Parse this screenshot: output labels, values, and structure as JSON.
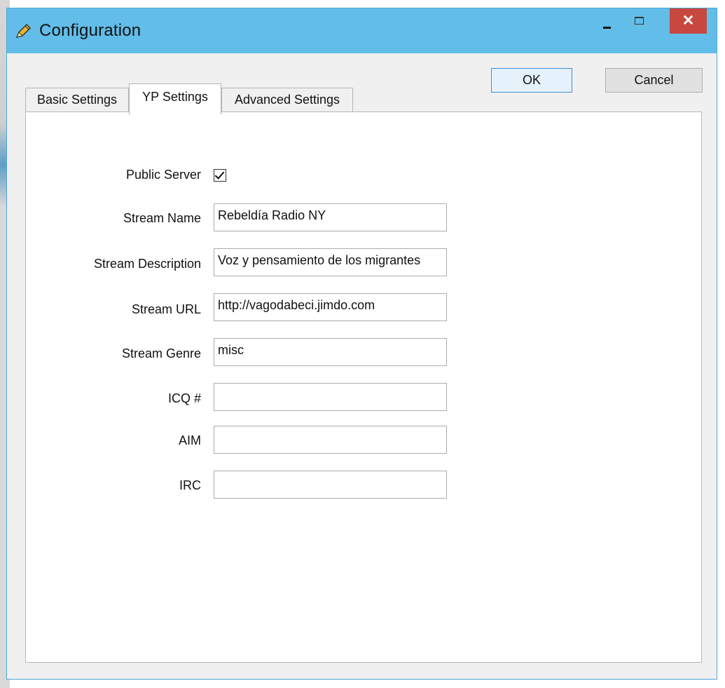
{
  "window": {
    "title": "Configuration",
    "close_glyph": "✕",
    "title_icon": "pencil-icon"
  },
  "buttons": {
    "ok": "OK",
    "cancel": "Cancel"
  },
  "tabs": [
    {
      "label": "Basic Settings",
      "active": false
    },
    {
      "label": "YP Settings",
      "active": true
    },
    {
      "label": "Advanced Settings",
      "active": false
    }
  ],
  "form": {
    "public_server": {
      "label": "Public Server",
      "checked": true
    },
    "stream_name": {
      "label": "Stream Name",
      "value": "Rebeldía Radio NY"
    },
    "stream_description": {
      "label": "Stream Description",
      "value": "Voz y pensamiento de los migrantes"
    },
    "stream_url": {
      "label": "Stream URL",
      "value": "http://vagodabeci.jimdo.com"
    },
    "stream_genre": {
      "label": "Stream Genre",
      "value": "misc"
    },
    "icq": {
      "label": "ICQ #",
      "value": ""
    },
    "aim": {
      "label": "AIM",
      "value": ""
    },
    "irc": {
      "label": "IRC",
      "value": ""
    }
  },
  "colors": {
    "titlebar": "#62bde8",
    "close_button": "#c7483f",
    "ok_border": "#3c8fd8"
  }
}
